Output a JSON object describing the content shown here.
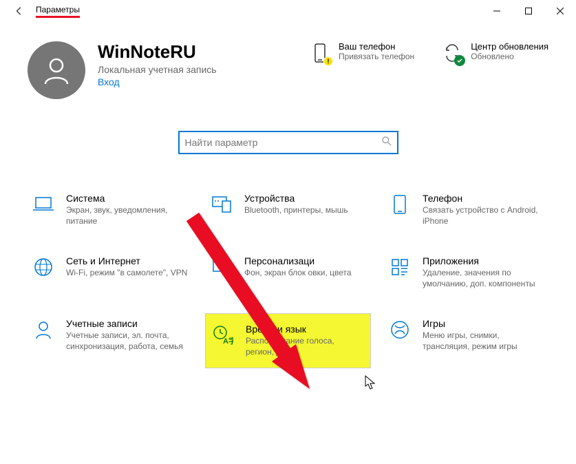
{
  "window": {
    "title": "Параметры"
  },
  "account": {
    "name": "WinNoteRU",
    "sub": "Локальная учетная запись",
    "link": "Вход"
  },
  "status": {
    "phone": {
      "title": "Ваш телефон",
      "sub": "Привязать телефон"
    },
    "update": {
      "title": "Центр обновления",
      "sub": "Обновлено"
    }
  },
  "search": {
    "placeholder": "Найти параметр"
  },
  "tiles": [
    {
      "title": "Система",
      "desc": "Экран, звук, уведомления, питание"
    },
    {
      "title": "Устройства",
      "desc": "Bluetooth, принтеры, мышь"
    },
    {
      "title": "Телефон",
      "desc": "Связать устройство с Android, iPhone"
    },
    {
      "title": "Сеть и Интернет",
      "desc": "Wi-Fi, режим \"в самолете\", VPN"
    },
    {
      "title": "Персонализаци",
      "desc": "Фон, экран блок     овки, цвета"
    },
    {
      "title": "Приложения",
      "desc": "Удаление, значения по умолчанию, доп. компоненты"
    },
    {
      "title": "Учетные записи",
      "desc": "Учетные записи, эл. почта, синхронизация, работа, семья"
    },
    {
      "title": "Время и язык",
      "desc": "Распознавание голоса, регион, дата"
    },
    {
      "title": "Игры",
      "desc": "Меню игры, снимки, трансляция, режим игры"
    }
  ]
}
